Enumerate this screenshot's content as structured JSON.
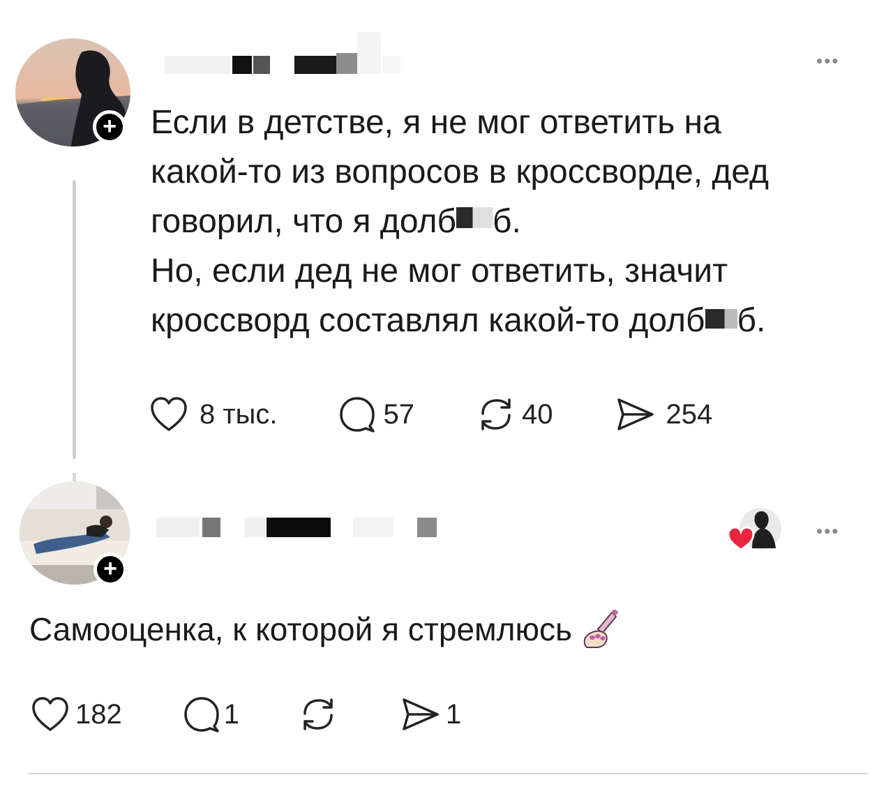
{
  "post": {
    "text_lines": [
      "Если в детстве, я не мог ответить на",
      "какой-то из вопросов в кроссворде, дед",
      "говорил, что я долб",
      "б.",
      "Но, если дед не мог ответить, значит",
      "кроссворд составлял какой-то долб",
      "б."
    ],
    "likes": "8 тыс.",
    "comments": "57",
    "reposts": "40",
    "shares": "254",
    "more_label": "•••"
  },
  "reply": {
    "text": "Самооценка, к которой я стремлюсь",
    "likes": "182",
    "comments": "1",
    "shares": "1",
    "more_label": "•••"
  },
  "icons": {
    "like": "heart-icon",
    "comment": "speech-bubble-icon",
    "repost": "repost-icon",
    "share": "send-icon",
    "follow": "plus-icon",
    "nail": "nail-polish-emoji-icon"
  },
  "colors": {
    "text": "#1a1a1a",
    "icon": "#222222",
    "heart_badge": "#e8263f",
    "thread_line": "#cfcfcf"
  }
}
